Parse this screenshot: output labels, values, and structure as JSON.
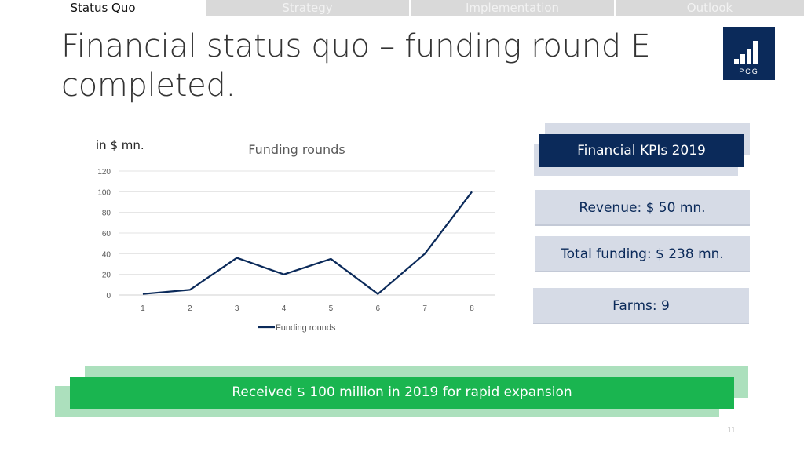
{
  "nav": {
    "tabs": [
      {
        "label": "Status Quo",
        "active": true
      },
      {
        "label": "Strategy",
        "active": false
      },
      {
        "label": "Implementation",
        "active": false
      },
      {
        "label": "Outlook",
        "active": false
      }
    ]
  },
  "slide": {
    "title": "Financial status quo – funding round E completed.",
    "page_number": "11"
  },
  "logo": {
    "text": "PCG",
    "icon": "bar-chart-logo-icon"
  },
  "chart_data": {
    "type": "line",
    "title": "Funding rounds",
    "unit_label": "in $ mn.",
    "x": [
      1,
      2,
      3,
      4,
      5,
      6,
      7,
      8
    ],
    "series": [
      {
        "name": "Funding rounds",
        "values": [
          1,
          5,
          36,
          20,
          35,
          1,
          40,
          100
        ],
        "color": "#0b2a5a"
      }
    ],
    "ylim": [
      0,
      120
    ],
    "yticks": [
      0,
      20,
      40,
      60,
      80,
      100,
      120
    ],
    "grid": true,
    "legend_position": "bottom"
  },
  "kpis": {
    "header": "Financial KPIs 2019",
    "items": [
      {
        "label": "Revenue: $ 50 mn."
      },
      {
        "label": "Total funding: $ 238 mn."
      },
      {
        "label": "Farms: 9"
      }
    ]
  },
  "banner": {
    "text": "Received $ 100 million in 2019 for rapid expansion"
  },
  "colors": {
    "navy": "#0b2a5a",
    "green": "#1ab550",
    "light_green": "#ace0bd",
    "kpi_background": "#d6dbe6"
  }
}
